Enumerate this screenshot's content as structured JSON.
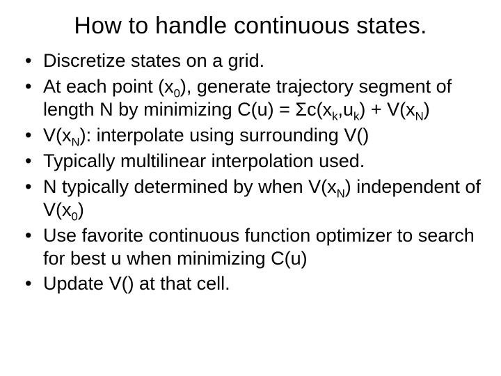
{
  "slide": {
    "title": "How to handle continuous states.",
    "bullets": [
      {
        "text": "Discretize states on a grid."
      },
      {
        "prefix": "At each point (x",
        "sub1": "0",
        "mid1": "), generate trajectory segment of length N by minimizing C(u) = Σc(x",
        "sub2": "k",
        "mid2": ",u",
        "sub3": "k",
        "mid3": ") + V(x",
        "sub4": "N",
        "suffix": ")"
      },
      {
        "prefix": "V(x",
        "sub1": "N",
        "suffix": "): interpolate using surrounding V()"
      },
      {
        "text": "Typically multilinear interpolation used."
      },
      {
        "prefix": "N typically determined by when V(x",
        "sub1": "N",
        "mid1": ") independent of V(x",
        "sub2": "0",
        "suffix": ")"
      },
      {
        "text": "Use favorite continuous function optimizer to search for best u when minimizing C(u)"
      },
      {
        "text": "Update V() at that cell."
      }
    ]
  }
}
